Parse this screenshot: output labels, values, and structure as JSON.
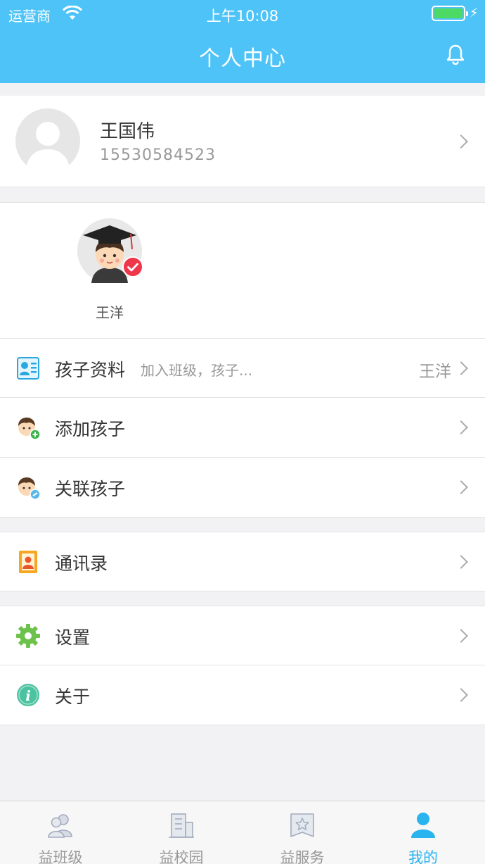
{
  "status_bar": {
    "carrier": "运营商",
    "time": "上午10:08"
  },
  "nav": {
    "title": "个人中心"
  },
  "profile": {
    "name": "王国伟",
    "phone": "15530584523"
  },
  "children": [
    {
      "name": "王洋"
    }
  ],
  "menu": {
    "child_info": {
      "label": "孩子资料",
      "subtitle": "加入班级，孩子...",
      "value": "王洋"
    },
    "add_child": {
      "label": "添加孩子"
    },
    "link_child": {
      "label": "关联孩子"
    },
    "contacts": {
      "label": "通讯录"
    },
    "settings": {
      "label": "设置"
    },
    "about": {
      "label": "关于"
    }
  },
  "tabs": [
    {
      "label": "益班级",
      "icon": "class-icon",
      "active": false
    },
    {
      "label": "益校园",
      "icon": "campus-icon",
      "active": false
    },
    {
      "label": "益服务",
      "icon": "service-icon",
      "active": false
    },
    {
      "label": "我的",
      "icon": "user-icon",
      "active": true
    }
  ],
  "colors": {
    "header": "#4ec3f7",
    "active_tab": "#29b4f0",
    "battery": "#4cd964",
    "verified_badge": "#f0364a"
  }
}
